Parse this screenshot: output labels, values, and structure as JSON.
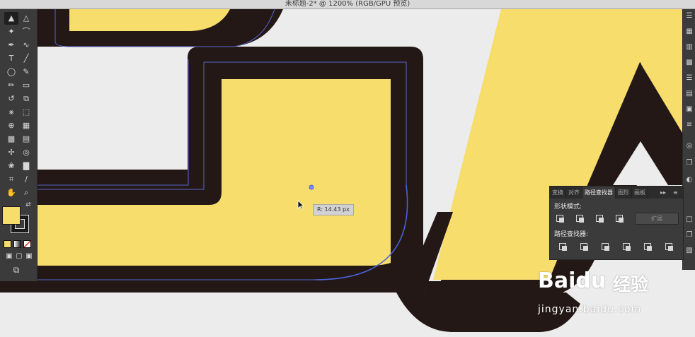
{
  "window": {
    "title": "未标题-2* @ 1200% (RGB/GPU 预览)"
  },
  "colors": {
    "fill": "#f6dd6c",
    "stroke": "#231815",
    "canvas": "#ececec",
    "path_guide": "#5566cc",
    "panel_bg": "#3b3b3b"
  },
  "tools": {
    "icons": [
      "selection-tool",
      "direct-selection-tool",
      "magic-wand-tool",
      "lasso-tool",
      "pen-tool",
      "curvature-tool",
      "type-tool",
      "line-tool",
      "ellipse-tool",
      "paintbrush-tool",
      "pencil-tool",
      "eraser-tool",
      "rotate-tool",
      "scale-tool",
      "width-tool",
      "free-transform-tool",
      "shape-builder-tool",
      "perspective-grid-tool",
      "mesh-tool",
      "gradient-tool",
      "eyedropper-tool",
      "blend-tool",
      "symbol-sprayer-tool",
      "column-graph-tool",
      "artboard-tool",
      "slice-tool",
      "hand-tool",
      "zoom-tool"
    ]
  },
  "canvas": {
    "radius_readout": "R: 14.43 px"
  },
  "pathfinder_panel": {
    "tabs": [
      "变换",
      "对齐",
      "路径查找器",
      "图形",
      "画板"
    ],
    "shape_modes_label": "形状模式:",
    "pathfinders_label": "路径查找器:",
    "expand_label": "扩展",
    "shape_mode_buttons": [
      "unite-icon",
      "minus-front-icon",
      "intersect-icon",
      "exclude-icon"
    ],
    "pathfinder_buttons": [
      "divide-icon",
      "trim-icon",
      "merge-icon",
      "crop-icon",
      "outline-icon",
      "minus-back-icon"
    ]
  },
  "watermark": {
    "brand": "Baidu",
    "cn": "经验",
    "url": "jingyan.baidu.com"
  }
}
